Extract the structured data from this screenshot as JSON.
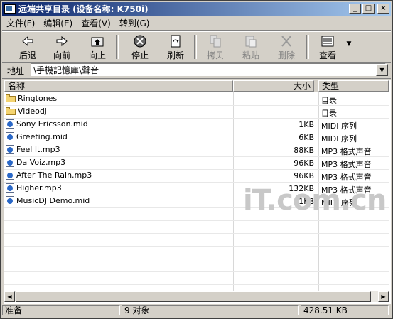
{
  "window": {
    "title": "远端共享目录 (设备名称: K750i)"
  },
  "menu": [
    "文件(F)",
    "编辑(E)",
    "查看(V)",
    "转到(G)"
  ],
  "toolbar": {
    "back": "后退",
    "forward": "向前",
    "up": "向上",
    "stop": "停止",
    "refresh": "刷新",
    "copy": "拷贝",
    "paste": "粘贴",
    "delete": "删除",
    "view": "查看"
  },
  "address": {
    "label": "地址",
    "value": "\\手機記憶庫\\聲音"
  },
  "columns": {
    "name": "名称",
    "size": "大小",
    "type": "类型"
  },
  "files": [
    {
      "name": "Ringtones",
      "size": "",
      "type": "目录",
      "kind": "folder"
    },
    {
      "name": "Videodj",
      "size": "",
      "type": "目录",
      "kind": "folder"
    },
    {
      "name": "Sony Ericsson.mid",
      "size": "1KB",
      "type": "MIDI 序列",
      "kind": "media"
    },
    {
      "name": "Greeting.mid",
      "size": "6KB",
      "type": "MIDI 序列",
      "kind": "media"
    },
    {
      "name": "Feel It.mp3",
      "size": "88KB",
      "type": "MP3 格式声音",
      "kind": "media"
    },
    {
      "name": "Da Voiz.mp3",
      "size": "96KB",
      "type": "MP3 格式声音",
      "kind": "media"
    },
    {
      "name": "After The Rain.mp3",
      "size": "96KB",
      "type": "MP3 格式声音",
      "kind": "media"
    },
    {
      "name": "Higher.mp3",
      "size": "132KB",
      "type": "MP3 格式声音",
      "kind": "media"
    },
    {
      "name": "MusicDJ Demo.mid",
      "size": "11KB",
      "type": "MIDI 序列",
      "kind": "media"
    }
  ],
  "status": {
    "state": "准备",
    "count": "9 对象",
    "total": "428.51 KB"
  },
  "watermark": "iT.com.cn"
}
